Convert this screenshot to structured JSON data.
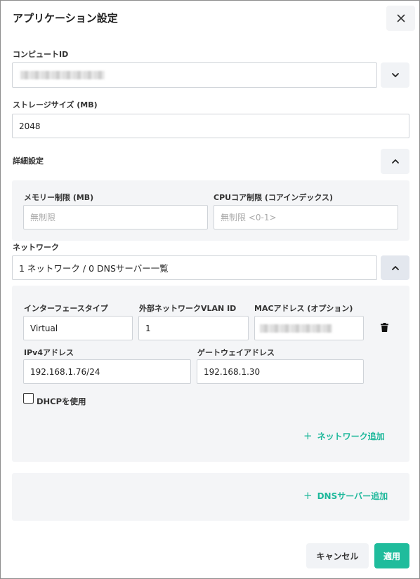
{
  "dialog": {
    "title": "アプリケーション設定"
  },
  "computer": {
    "label": "コンピュートID"
  },
  "storage": {
    "label": "ストレージサイズ (MB)",
    "value": "2048"
  },
  "advanced": {
    "label": "詳細設定",
    "memory_label": "メモリー制限 (MB)",
    "memory_placeholder": "無制限",
    "cpu_label": "CPUコア制限 (コアインデックス)",
    "cpu_placeholder": "無制限 <0-1>"
  },
  "network": {
    "label": "ネットワーク",
    "summary": "1 ネットワーク / 0 DNSサーバー一覧",
    "interface_type_label": "インターフェースタイプ",
    "interface_type_value": "Virtual",
    "vlan_label": "外部ネットワークVLAN ID",
    "vlan_value": "1",
    "mac_label": "MACアドレス (オプション)",
    "ipv4_label": "IPv4アドレス",
    "ipv4_value": "192.168.1.76/24",
    "gateway_label": "ゲートウェイアドレス",
    "gateway_value": "192.168.1.30",
    "dhcp_label": "DHCPを使用",
    "add_network_label": "ネットワーク追加",
    "add_dns_label": "DNSサーバー追加"
  },
  "footer": {
    "cancel_label": "キャンセル",
    "apply_label": "適用"
  },
  "colors": {
    "accent": "#1fbc9c",
    "panel": "#f4f5f7"
  },
  "icons": [
    "close-icon",
    "chevron-down-icon",
    "chevron-up-icon",
    "trash-icon",
    "plus-icon"
  ]
}
